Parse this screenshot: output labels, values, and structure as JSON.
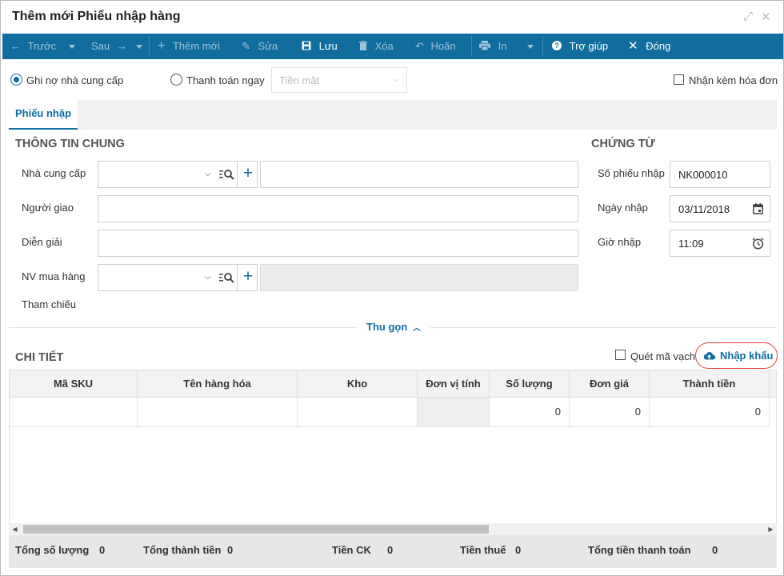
{
  "window": {
    "title": "Thêm mới Phiếu nhập hàng"
  },
  "toolbar": {
    "prev": "Trước",
    "next": "Sau",
    "add": "Thêm mới",
    "edit": "Sửa",
    "save": "Lưu",
    "delete": "Xóa",
    "undo": "Hoãn",
    "print": "In",
    "help": "Trợ giúp",
    "close": "Đóng"
  },
  "payment": {
    "option_debt": "Ghi nợ nhà cung cấp",
    "option_pay_now": "Thanh toán ngay",
    "method_placeholder": "Tiền mặt",
    "with_invoice": "Nhận kèm hóa đơn",
    "selected": "option_debt"
  },
  "tabs": [
    {
      "label": "Phiếu nhập",
      "active": true
    }
  ],
  "general": {
    "title": "THÔNG TIN CHUNG",
    "supplier_label": "Nhà cung cấp",
    "deliverer_label": "Người giao",
    "description_label": "Diễn giải",
    "buyer_label": "NV mua hàng",
    "reference_label": "Tham chiếu"
  },
  "document": {
    "title": "CHỨNG TỪ",
    "number_label": "Số phiếu nhập",
    "number_value": "NK000010",
    "date_label": "Ngày nhập",
    "date_value": "03/11/2018",
    "time_label": "Giờ nhập",
    "time_value": "11:09"
  },
  "collapse_label": "Thu gọn",
  "detail": {
    "title": "CHI TIẾT",
    "barcode_label": "Quét mã vạch",
    "import_label": "Nhập khẩu",
    "columns": [
      "Mã SKU",
      "Tên hàng hóa",
      "Kho",
      "Đơn vị tính",
      "Số lượng",
      "Đơn giá",
      "Thành tiền"
    ],
    "rows": [
      {
        "sku": "",
        "name": "",
        "warehouse": "",
        "unit": "",
        "qty": "0",
        "price": "0",
        "amount": "0"
      }
    ]
  },
  "totals": {
    "qty_label": "Tổng số lượng",
    "qty_value": "0",
    "amount_label": "Tổng thành tiền",
    "amount_value": "0",
    "discount_label": "Tiền CK",
    "discount_value": "0",
    "tax_label": "Tiền thuế",
    "tax_value": "0",
    "payment_label": "Tổng tiền thanh toán",
    "payment_value": "0"
  },
  "colors": {
    "primary": "#106d9e",
    "highlight": "#e0413c"
  },
  "icons": [
    "arrow-left-icon",
    "arrow-right-icon",
    "plus-icon",
    "pencil-icon",
    "save-icon",
    "trash-icon",
    "undo-icon",
    "printer-icon",
    "help-icon",
    "close-icon",
    "expand-icon",
    "search-icon",
    "calendar-icon",
    "clock-icon",
    "cloud-upload-icon",
    "chevron-down-icon",
    "chevron-up-icon"
  ]
}
